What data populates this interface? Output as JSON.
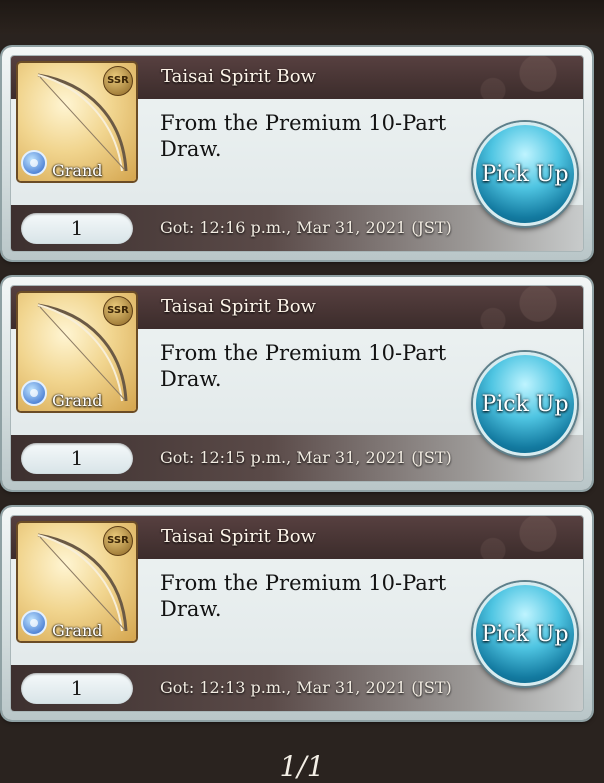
{
  "items": [
    {
      "name": "Taisai Spirit Bow",
      "description": "From the Premium 10-Part Draw.",
      "rarity": "SSR",
      "series": "Grand",
      "count": "1",
      "obtained": "Got: 12:16 p.m., Mar 31, 2021 (JST)",
      "button_label": "Pick Up"
    },
    {
      "name": "Taisai Spirit Bow",
      "description": "From the Premium 10-Part Draw.",
      "rarity": "SSR",
      "series": "Grand",
      "count": "1",
      "obtained": "Got: 12:15 p.m., Mar 31, 2021 (JST)",
      "button_label": "Pick Up"
    },
    {
      "name": "Taisai Spirit Bow",
      "description": "From the Premium 10-Part Draw.",
      "rarity": "SSR",
      "series": "Grand",
      "count": "1",
      "obtained": "Got: 12:13 p.m., Mar 31, 2021 (JST)",
      "button_label": "Pick Up"
    }
  ],
  "pagination": {
    "label": "1/1"
  },
  "colors": {
    "background": "#2a231f",
    "title_bar": "#4a3635",
    "pickup_button": "#3fb4d8",
    "card_panel": "#e4ebec"
  },
  "icons": {
    "item_thumbnail": "bow-icon",
    "element": "water-element-icon",
    "rarity": "ssr-badge"
  }
}
